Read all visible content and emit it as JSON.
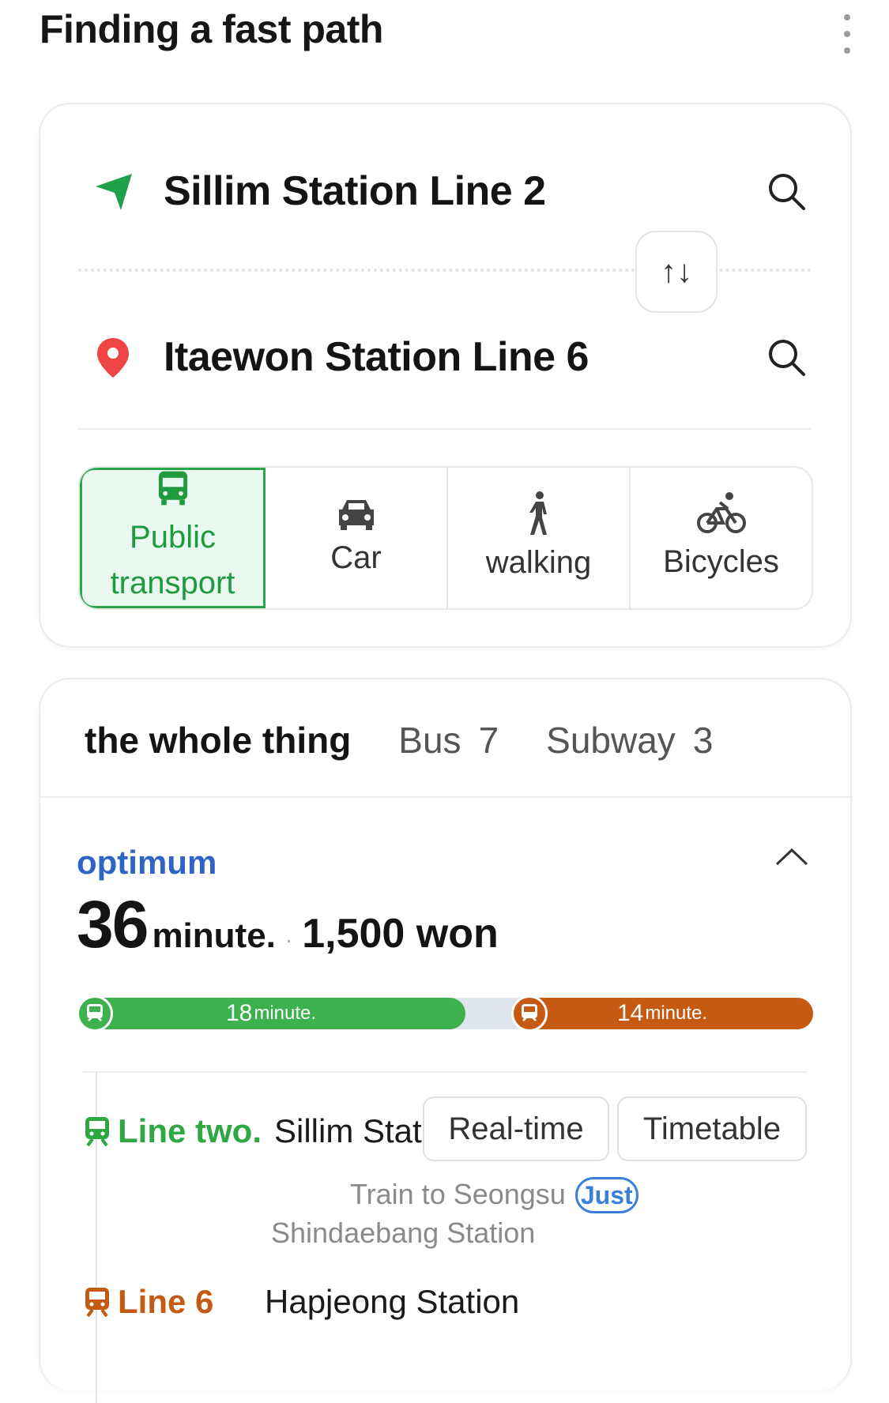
{
  "header": {
    "title": "Finding a fast path",
    "more_icon": "more-vertical-icon"
  },
  "route": {
    "origin": {
      "name": "Sillim Station Line 2",
      "icon": "navigation-arrow-icon",
      "icon_color": "#1fa04a"
    },
    "destination": {
      "name": "Itaewon Station Line 6",
      "icon": "location-pin-icon",
      "icon_color": "#ef4444"
    },
    "swap_label": "↑↓",
    "modes": [
      {
        "label": "Public transport",
        "icon": "bus-icon",
        "active": true
      },
      {
        "label": "Car",
        "icon": "car-icon",
        "active": false
      },
      {
        "label": "walking",
        "icon": "walking-person-icon",
        "active": false
      },
      {
        "label": "Bicycles",
        "icon": "bicycle-icon",
        "active": false
      }
    ]
  },
  "results": {
    "tabs": [
      {
        "label": "the whole thing",
        "count": ""
      },
      {
        "label": "Bus",
        "count": "7"
      },
      {
        "label": "Subway",
        "count": "3"
      }
    ],
    "best": {
      "tag": "optimum",
      "duration_value": "36",
      "duration_unit": "minute.",
      "price": "1,500 won",
      "segments": [
        {
          "value": "18",
          "unit": "minute.",
          "color": "#3db14d"
        },
        {
          "value": "14",
          "unit": "minute.",
          "color": "#c75a12"
        }
      ],
      "steps": [
        {
          "line": "Line two.",
          "line_color": "#2fa843",
          "station": "Sillim Station",
          "buttons": [
            "Real-time",
            "Timetable"
          ],
          "direction": "Train to Seongsu",
          "badge": "Just",
          "next_station": "Shindaebang Station"
        },
        {
          "line": "Line 6",
          "line_color": "#c45b14",
          "station": "Hapjeong Station"
        }
      ]
    }
  }
}
